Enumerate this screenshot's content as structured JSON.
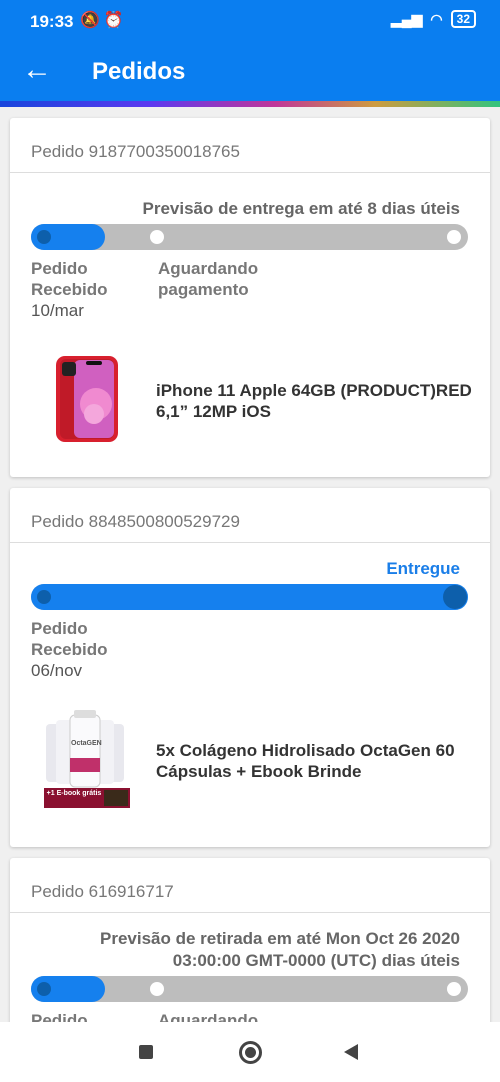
{
  "status_bar": {
    "time": "19:33",
    "battery": "32"
  },
  "header": {
    "title": "Pedidos"
  },
  "orders": [
    {
      "id_label": "Pedido 9187700350018765",
      "estimate": "Previsão de entrega em até 8 dias úteis",
      "progress_fraction": 0.17,
      "steps": [
        {
          "line1": "Pedido",
          "line2": "Recebido",
          "date": "10/mar"
        },
        {
          "line1": "Aguardando",
          "line2": "pagamento"
        }
      ],
      "product_name": "iPhone 11 Apple 64GB (PRODUCT)RED 6,1” 12MP iOS"
    },
    {
      "id_label": "Pedido 8848500800529729",
      "estimate": "Entregue",
      "progress_fraction": 1.0,
      "steps": [
        {
          "line1": "Pedido",
          "line2": "Recebido",
          "date": "06/nov"
        }
      ],
      "product_name": "5x Colágeno Hidrolisado OctaGen 60 Cápsulas + Ebook Brinde",
      "product_image_text": {
        "brand": "OctaGEN",
        "banner": "+1 E-book grátis"
      }
    },
    {
      "id_label": "Pedido 616916717",
      "estimate_line1": "Previsão de retirada em até Mon Oct 26 2020",
      "estimate_line2": "03:00:00 GMT-0000 (UTC) dias úteis",
      "progress_fraction": 0.17,
      "steps": [
        {
          "line1": "Pedido"
        },
        {
          "line1": "Aguardando"
        }
      ]
    }
  ],
  "colors": {
    "primary": "#0a7ef0",
    "progress": "#1580ee",
    "track": "#bdbdbd",
    "delivered": "#1a7ee8"
  }
}
